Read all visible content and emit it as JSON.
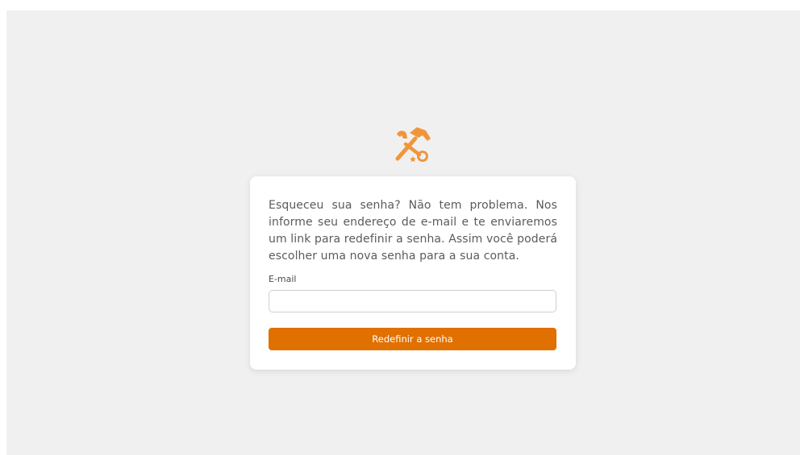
{
  "logo": {
    "icon": "wrench-hammer-icon",
    "color": "#f0963a"
  },
  "reset_form": {
    "intro": "Esqueceu sua senha? Não tem problema. Nos informe seu endereço de e-mail e te enviaremos um link para redefinir a senha. Assim você poderá escolher uma nova senha para a sua conta.",
    "email_label": "E-mail",
    "email_value": "",
    "email_placeholder": "",
    "submit_label": "Redefinir a senha"
  },
  "colors": {
    "accent": "#e07000",
    "background": "#f0f0f0",
    "card": "#ffffff"
  }
}
